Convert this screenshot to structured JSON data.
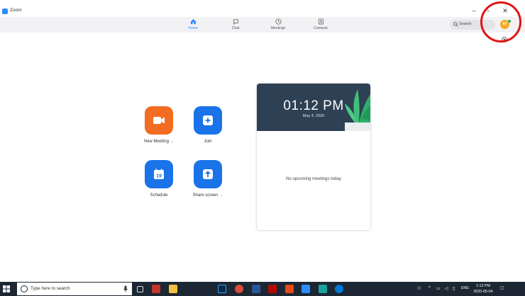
{
  "window": {
    "title": "Zoom",
    "min_glyph": "–",
    "max_glyph": "▫",
    "close_glyph": "✕"
  },
  "nav": {
    "tabs": [
      {
        "label": "Home",
        "icon": "home-icon",
        "active": true
      },
      {
        "label": "Chat",
        "icon": "chat-icon",
        "active": false
      },
      {
        "label": "Meetings",
        "icon": "clock-icon",
        "active": false
      },
      {
        "label": "Contacts",
        "icon": "contacts-icon",
        "active": false
      }
    ],
    "search_label": "Search",
    "avatar_initials": "AF"
  },
  "actions": [
    {
      "label": "New Meeting",
      "icon": "video-camera-icon",
      "color": "#f26d21",
      "has_caret": true
    },
    {
      "label": "Join",
      "icon": "plus-icon",
      "color": "#1a73e8",
      "has_caret": false
    },
    {
      "label": "Schedule",
      "icon": "calendar-icon",
      "color": "#1a73e8",
      "has_caret": false,
      "calendar_day": "19"
    },
    {
      "label": "Share screen",
      "icon": "share-arrow-icon",
      "color": "#1a73e8",
      "has_caret": true
    }
  ],
  "caret_glyph": "⌄",
  "calendar_card": {
    "time": "01:12 PM",
    "date": "May 4, 2020",
    "empty_message": "No upcoming meetings today"
  },
  "taskbar": {
    "search_placeholder": "Type here to search",
    "clock_time": "1:12 PM",
    "clock_date": "2020-05-04",
    "language": "ENG"
  },
  "colors": {
    "accent": "#2d8cff",
    "orange": "#f26d21",
    "blue": "#1a73e8",
    "card_header": "#2e4054",
    "highlight_ring": "#e01515"
  }
}
